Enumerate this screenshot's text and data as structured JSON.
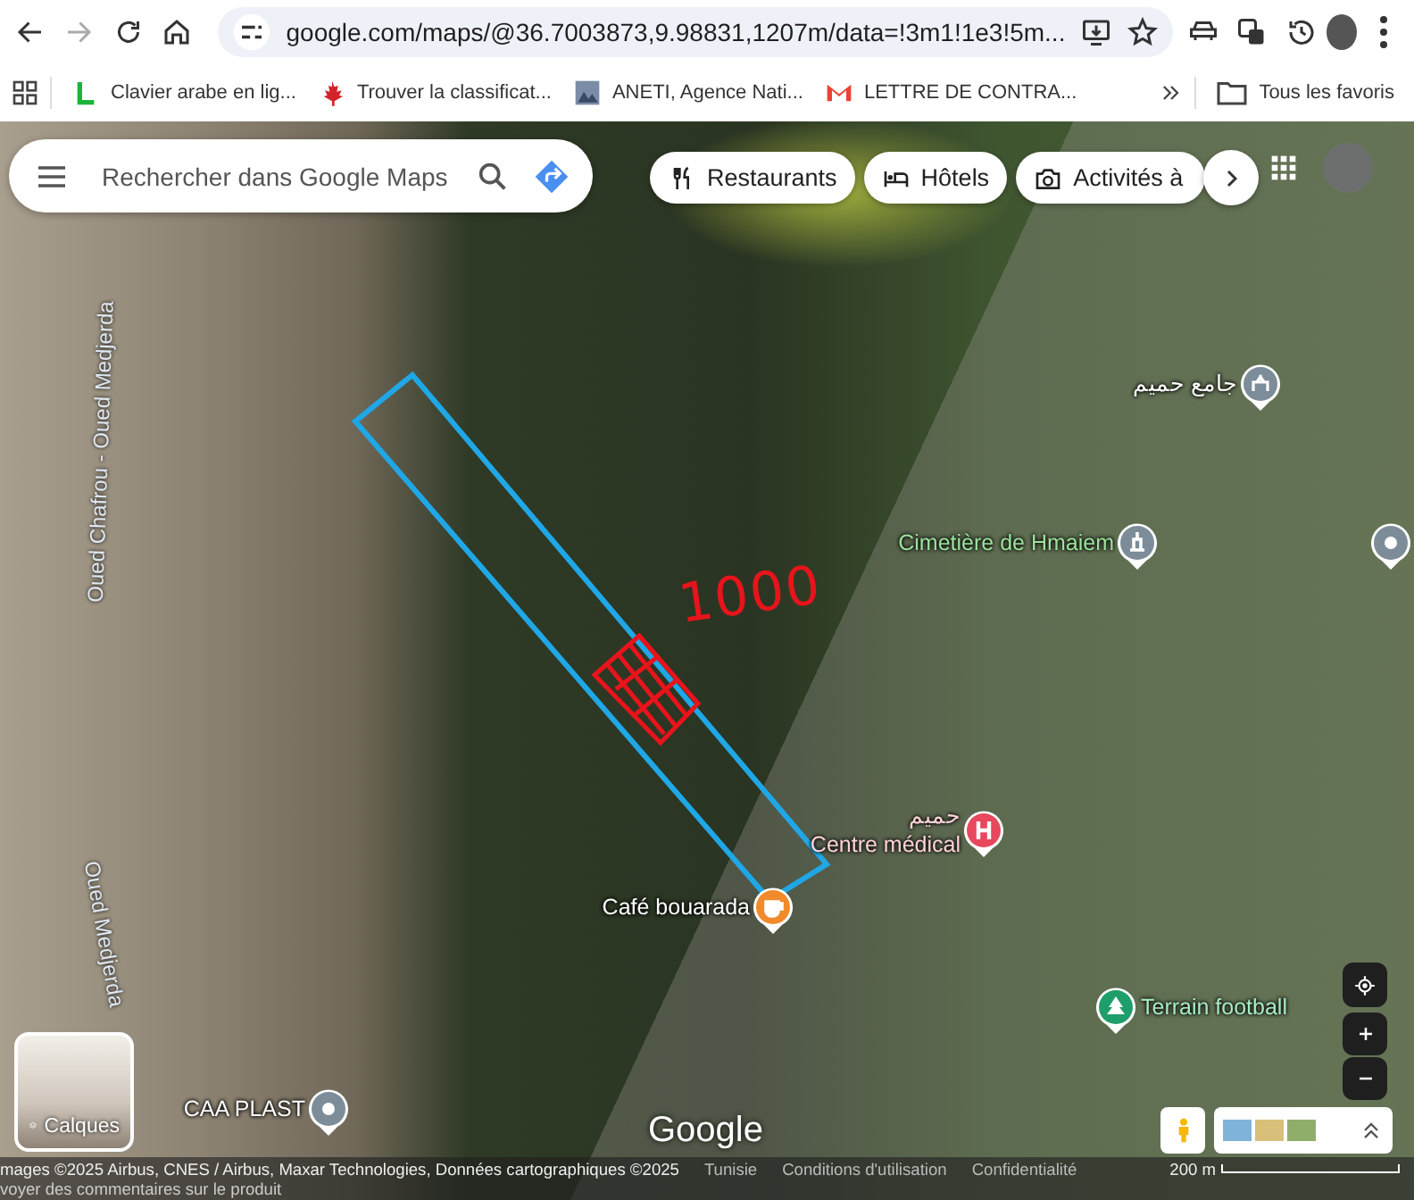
{
  "browser": {
    "url": "google.com/maps/@36.7003873,9.98831,1207m/data=!3m1!1e3!5m...",
    "bookmarks": [
      {
        "label": "Clavier arabe en lig...",
        "kind": "letter"
      },
      {
        "label": "Trouver la classificat...",
        "kind": "leaf"
      },
      {
        "label": "ANETI, Agence Nati...",
        "kind": "image"
      },
      {
        "label": "LETTRE DE CONTRA...",
        "kind": "mail"
      }
    ],
    "all_bookmarks": "Tous les favoris"
  },
  "search": {
    "placeholder": "Rechercher dans Google Maps"
  },
  "chips": [
    {
      "label": "Restaurants",
      "kind": "restaurant"
    },
    {
      "label": "Hôtels",
      "kind": "hotel"
    },
    {
      "label": "Activités à",
      "kind": "camera"
    }
  ],
  "rivers": [
    {
      "text": "Oued Chafrou - Oued Medjerda"
    },
    {
      "text": "Oued Medjerda"
    }
  ],
  "places": [
    {
      "names": [
        "جامع حميم"
      ],
      "kind": "mosque",
      "color": "#7c8c99"
    },
    {
      "names": [
        "Cimetière de Hmaiem"
      ],
      "kind": "cemetery",
      "color": "#7c8c99"
    },
    {
      "kind": "place",
      "color": "#7c8c99"
    },
    {
      "names": [
        "حميم",
        "Centre médical"
      ],
      "kind": "hospital",
      "color": "#e8475d"
    },
    {
      "names": [
        "Café bouarada"
      ],
      "kind": "cafe",
      "color": "#f08a2b"
    },
    {
      "names": [
        "Terrain football"
      ],
      "kind": "park",
      "color": "#1e9e6a"
    },
    {
      "names": [
        "CAA PLAST"
      ],
      "kind": "place",
      "color": "#7c8c99"
    }
  ],
  "annotation": "1000",
  "layers_button": "Calques",
  "logo": "Google",
  "footer": {
    "attribution": "mages ©2025 Airbus, CNES / Airbus, Maxar Technologies, Données cartographiques ©2025",
    "links": [
      "Tunisie",
      "Conditions d'utilisation",
      "Confidentialité"
    ],
    "scale": "200 m",
    "feedback": "voyer des commentaires sur le produit"
  }
}
